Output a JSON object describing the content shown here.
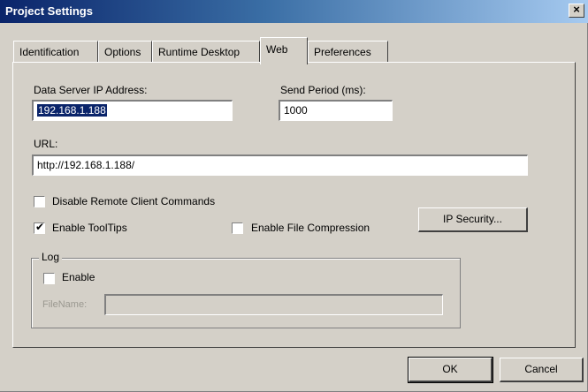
{
  "window": {
    "title": "Project Settings",
    "close_glyph": "×"
  },
  "tabs": [
    {
      "label": "Identification",
      "active": false
    },
    {
      "label": "Options",
      "active": false
    },
    {
      "label": "Runtime Desktop",
      "active": false
    },
    {
      "label": "Web",
      "active": true
    },
    {
      "label": "Preferences",
      "active": false
    }
  ],
  "web": {
    "ip_label": "Data Server IP Address:",
    "ip_value": "192.168.1.188",
    "period_label": "Send Period (ms):",
    "period_value": "1000",
    "url_label": "URL:",
    "url_value": "http://192.168.1.188/",
    "disable_remote_label": "Disable Remote Client Commands",
    "disable_remote_checked": false,
    "tooltips_label": "Enable ToolTips",
    "tooltips_checked": true,
    "compression_label": "Enable File Compression",
    "compression_checked": false,
    "ip_security_label": "IP Security..."
  },
  "log": {
    "group_label": "Log",
    "enable_label": "Enable",
    "enable_checked": false,
    "filename_label": "FileName:",
    "filename_value": ""
  },
  "footer": {
    "ok_label": "OK",
    "cancel_label": "Cancel"
  },
  "icons": {
    "check": "✔"
  }
}
